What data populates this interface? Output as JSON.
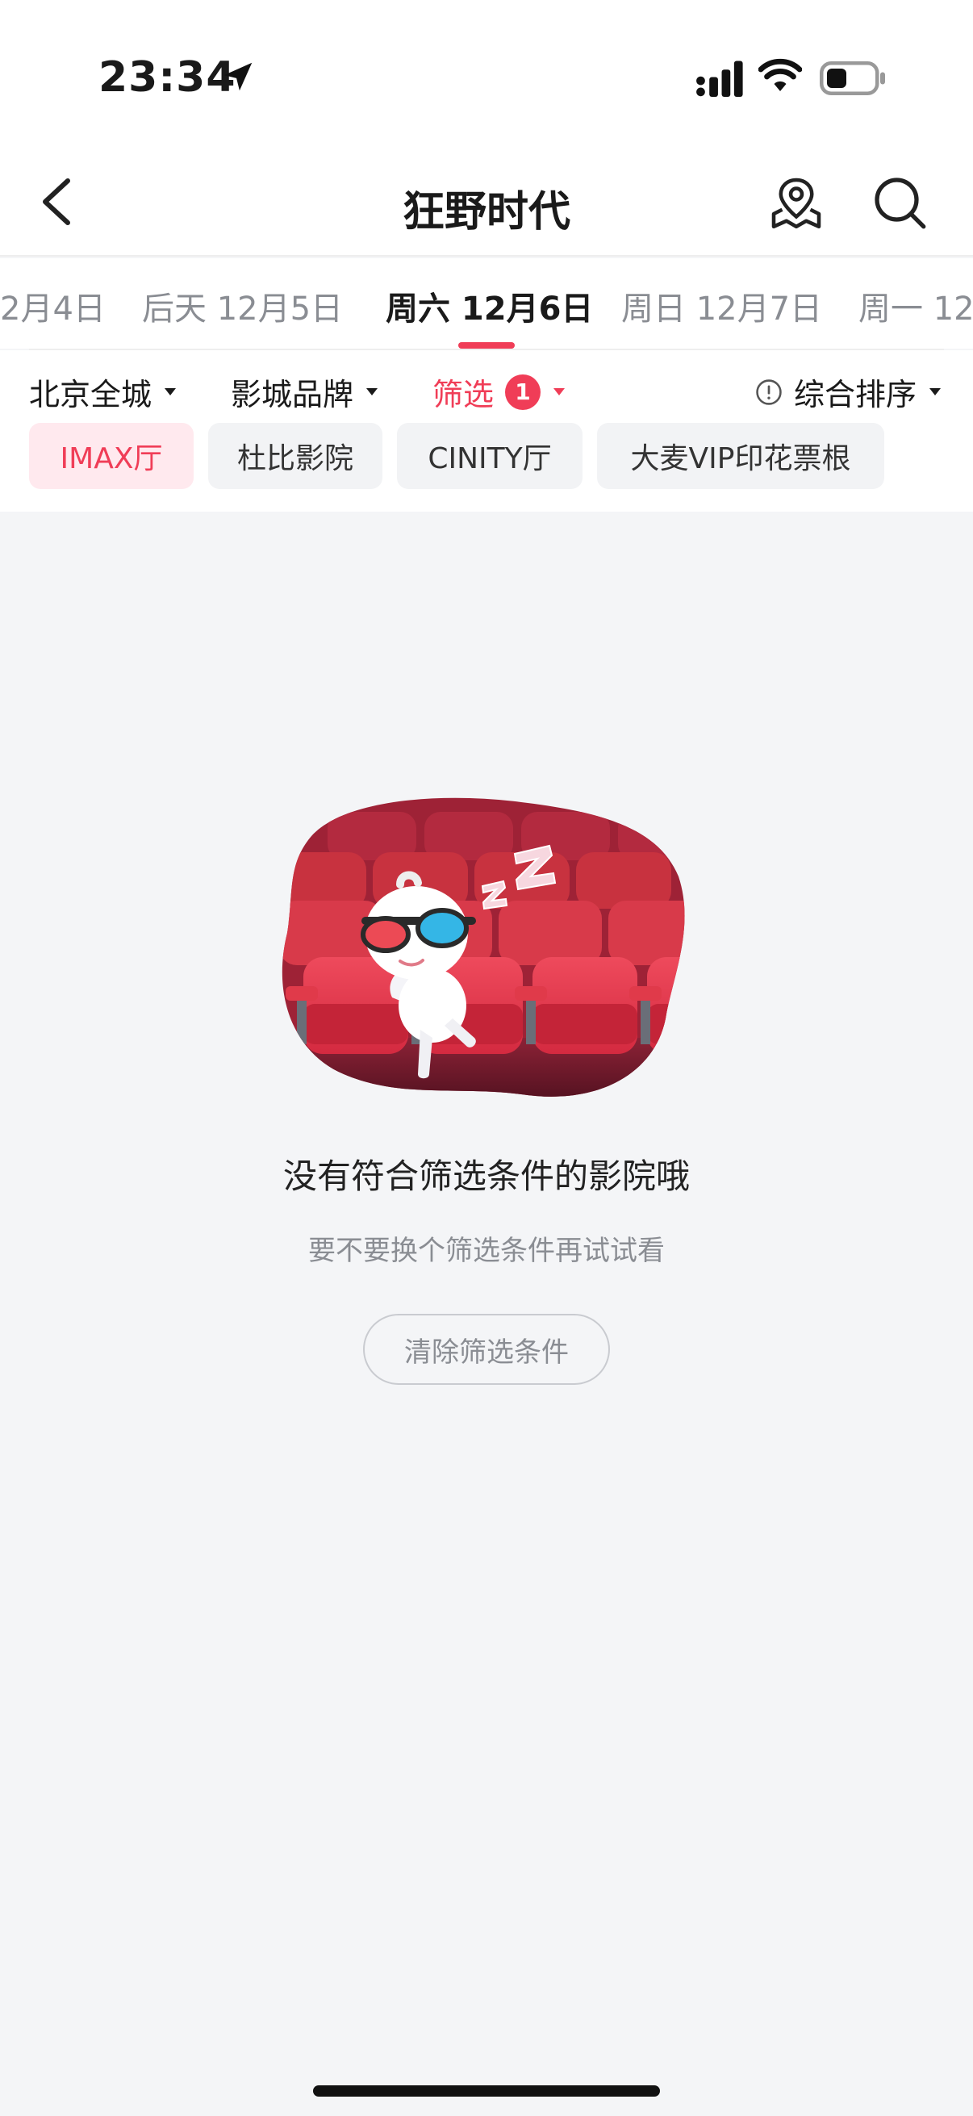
{
  "status_bar": {
    "time": "23:34"
  },
  "nav": {
    "title": "狂野时代"
  },
  "date_tabs": [
    {
      "label": "2月4日"
    },
    {
      "label": "后天 12月5日"
    },
    {
      "label": "周六 12月6日",
      "active": true
    },
    {
      "label": "周日 12月7日"
    },
    {
      "label": "周一 12"
    }
  ],
  "filters": {
    "city": "北京全城",
    "brand": "影城品牌",
    "screen": "筛选",
    "screen_count": "1",
    "sort": "综合排序"
  },
  "chips": [
    {
      "label": "IMAX厅",
      "selected": true
    },
    {
      "label": "杜比影院"
    },
    {
      "label": "CINITY厅"
    },
    {
      "label": "大麦VIP印花票根"
    }
  ],
  "empty_state": {
    "title": "没有符合筛选条件的影院哦",
    "subtitle": "要不要换个筛选条件再试试看",
    "clear_button": "清除筛选条件"
  },
  "colors": {
    "accent": "#f03d57",
    "chip_selected_bg": "#ffe9ee",
    "page_bg": "#f4f5f7"
  }
}
